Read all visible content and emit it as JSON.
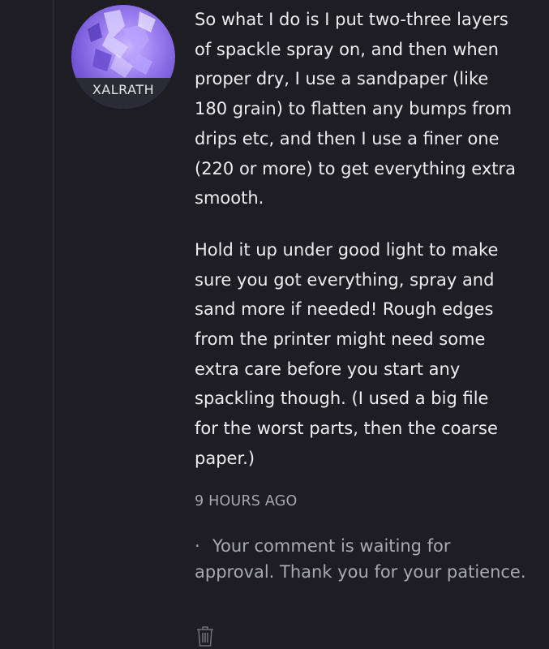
{
  "user": {
    "name": "XALRATH"
  },
  "comment": {
    "paragraphs": [
      "So what I do is I put two-three layers\nof spackle spray on, and then when\nproper dry, I use a sandpaper (like\n180 grain) to flatten any bumps from\ndrips etc, and then I use a finer one\n(220 or more) to get everything extra\nsmooth.",
      "Hold it up under good light to make\nsure you got everything, spray and\nsand more if needed! Rough edges\nfrom the printer might need some\nextra care before you start any\nspackling though. (I used a big file\nfor the worst parts, then the coarse\npaper.)"
    ],
    "timestamp": "9 HOURS AGO",
    "pending_bullet": "·",
    "pending_message": "Your comment is waiting for approval. Thank you for your patience."
  },
  "icons": {
    "delete": "trash-icon"
  },
  "colors": {
    "background": "#1d1d23",
    "avatar_accent": "#8b6ef0",
    "text": "#ececf1",
    "muted_text": "#a9a9b2"
  }
}
